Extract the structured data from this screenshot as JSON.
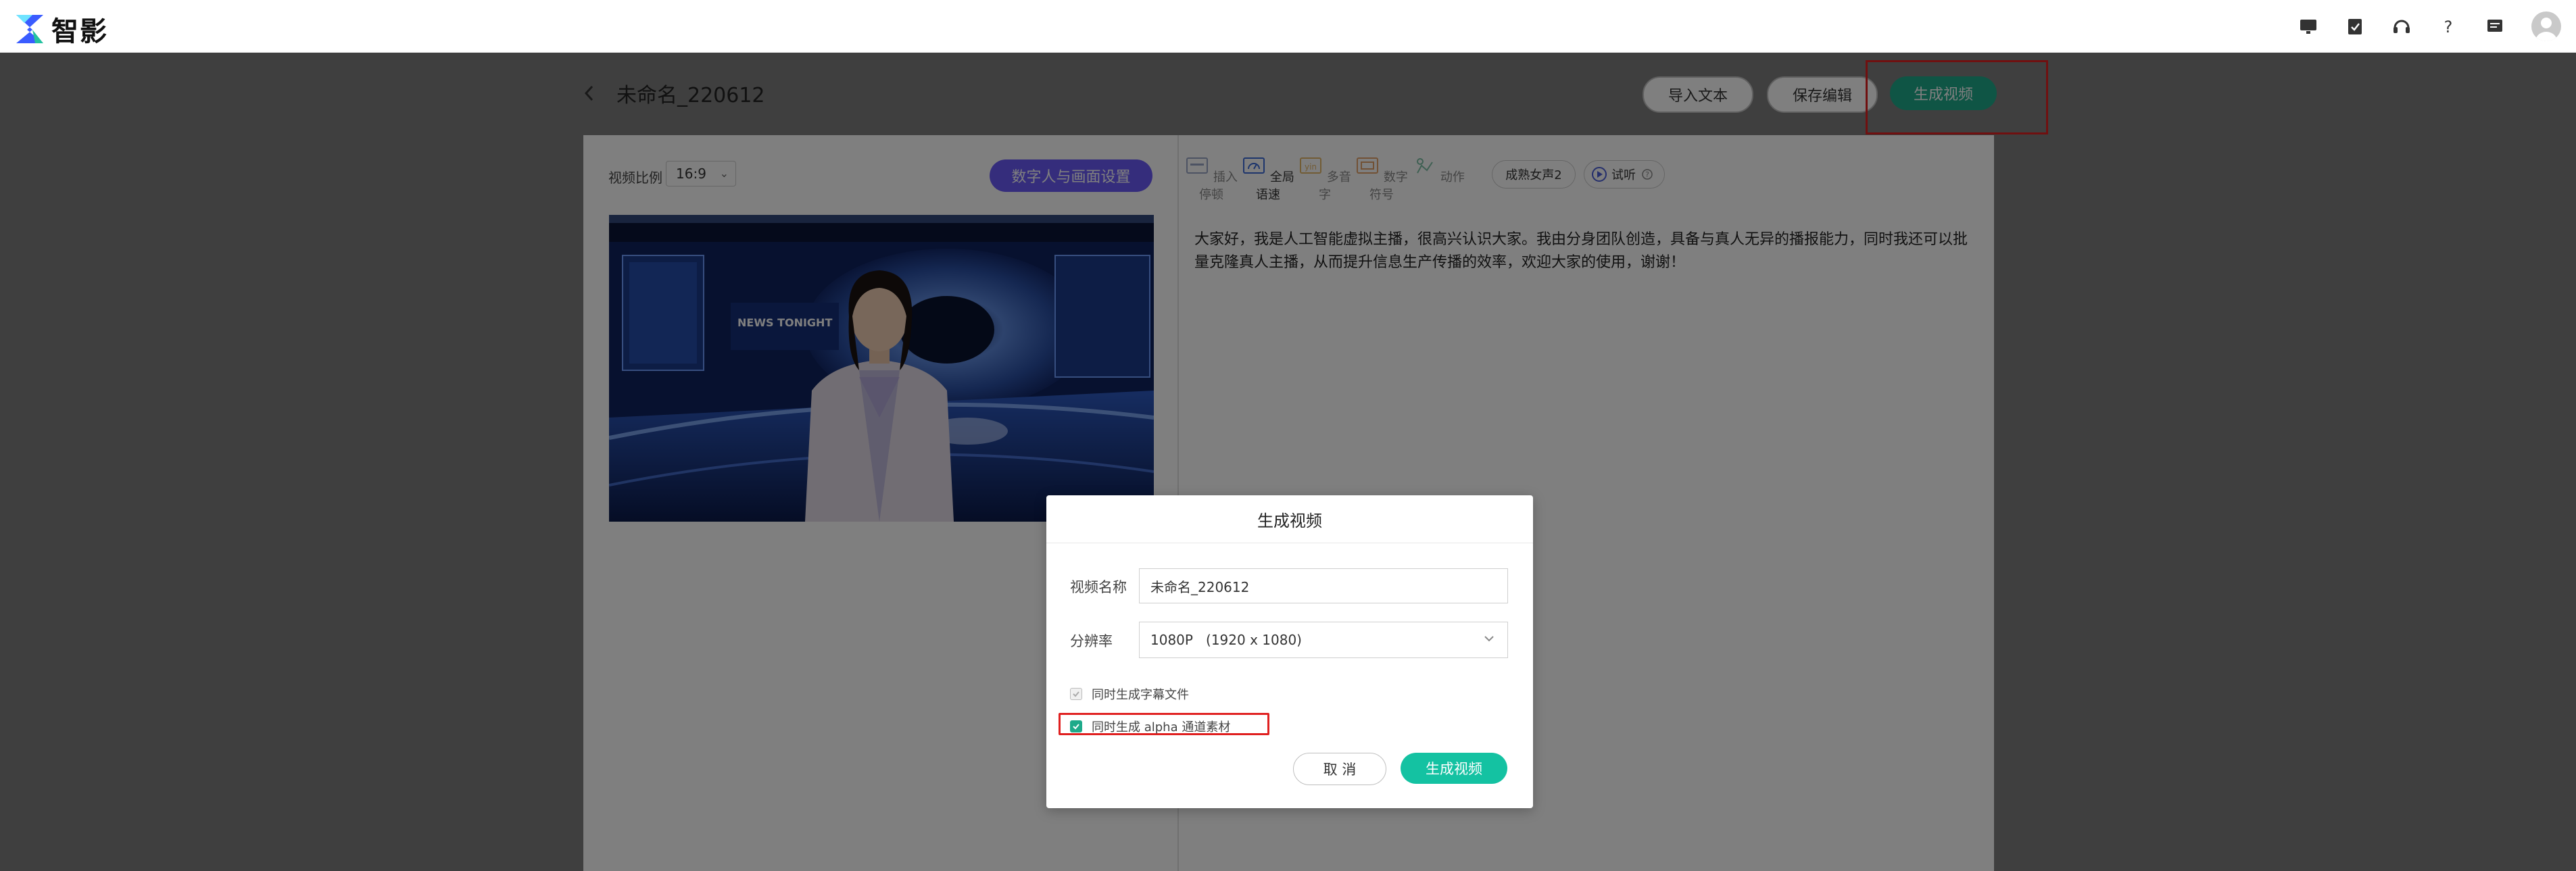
{
  "app": {
    "name": "智影"
  },
  "top_icons": [
    "monitor-icon",
    "clipboard-check-icon",
    "headset-icon",
    "help-icon",
    "message-icon",
    "avatar-icon"
  ],
  "project": {
    "title": "未命名_220612",
    "import_text_label": "导入文本",
    "save_edit_label": "保存编辑",
    "generate_label": "生成视频"
  },
  "left_panel": {
    "ratio_label": "视频比例",
    "ratio_value": "16:9",
    "avatar_settings_label": "数字人与画面设置",
    "preview_badge": "NEWS TONIGHT"
  },
  "toolbar": {
    "items": [
      {
        "label": "插入停顿",
        "icon": "pause-insert-icon"
      },
      {
        "label": "全局语速",
        "icon": "speed-icon"
      },
      {
        "label": "多音字",
        "icon": "polyphone-icon"
      },
      {
        "label": "数字符号",
        "icon": "number-symbol-icon"
      },
      {
        "label": "动作",
        "icon": "action-icon"
      }
    ],
    "voice_label": "成熟女声2",
    "listen_label": "试听"
  },
  "script_text": "大家好，我是人工智能虚拟主播，很高兴认识大家。我由分身团队创造，具备与真人无异的播报能力，同时我还可以批量克隆真人主播，从而提升信息生产传播的效率，欢迎大家的使用，谢谢！",
  "dialog": {
    "title": "生成视频",
    "name_label": "视频名称",
    "name_value": "未命名_220612",
    "resolution_label": "分辨率",
    "resolution_value": "1080P   (1920 x 1080)",
    "subtitle_option": "同时生成字幕文件",
    "alpha_option": "同时生成 alpha 通道素材",
    "cancel_label": "取 消",
    "confirm_label": "生成视频"
  },
  "colors": {
    "accent_green": "#1eaa8a",
    "confirm_green": "#14c2a2",
    "purple": "#6a5af9",
    "highlight_red": "#e02020"
  }
}
